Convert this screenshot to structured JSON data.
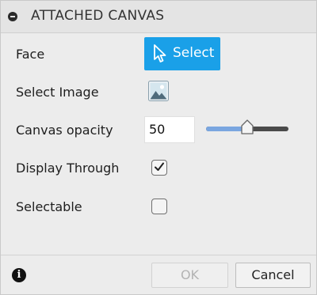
{
  "header": {
    "title": "ATTACHED CANVAS"
  },
  "rows": {
    "face": {
      "label": "Face",
      "button_label": "Select"
    },
    "select_image": {
      "label": "Select Image",
      "icon": "image-icon"
    },
    "opacity": {
      "label": "Canvas opacity",
      "value": "50",
      "slider_value": 50,
      "slider_max": 100
    },
    "display_through": {
      "label": "Display Through",
      "checked": true
    },
    "selectable": {
      "label": "Selectable",
      "checked": false
    }
  },
  "footer": {
    "ok_label": "OK",
    "cancel_label": "Cancel",
    "info_icon": "info-icon"
  },
  "colors": {
    "accent": "#1aa0e8",
    "slider_fill": "#7aa6e0",
    "slider_track": "#4a4a4a"
  }
}
